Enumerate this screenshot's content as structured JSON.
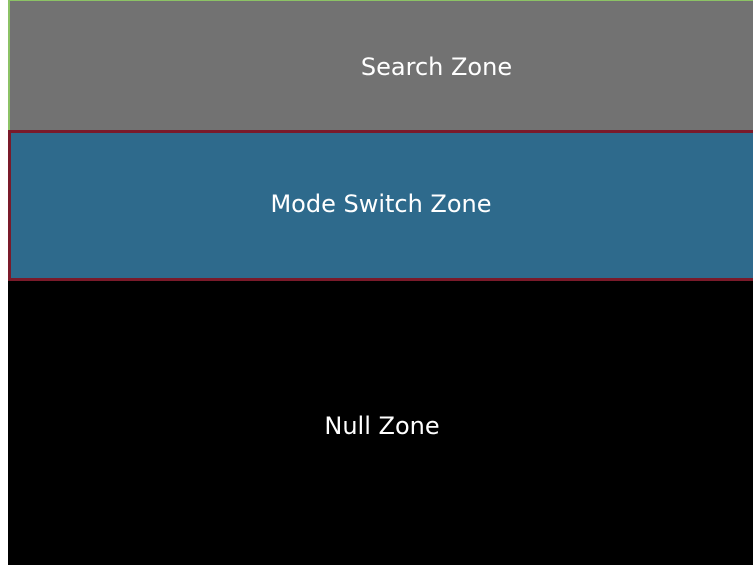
{
  "zones": {
    "search": {
      "label": "Search Zone",
      "color": "#727272"
    },
    "mode_switch": {
      "label": "Mode Switch Zone",
      "color": "#2e6a8c",
      "border_color": "#7a1a2a"
    },
    "null": {
      "label": "Null Zone",
      "color": "#000000"
    }
  },
  "accent": {
    "outline_color": "#8cc265"
  }
}
